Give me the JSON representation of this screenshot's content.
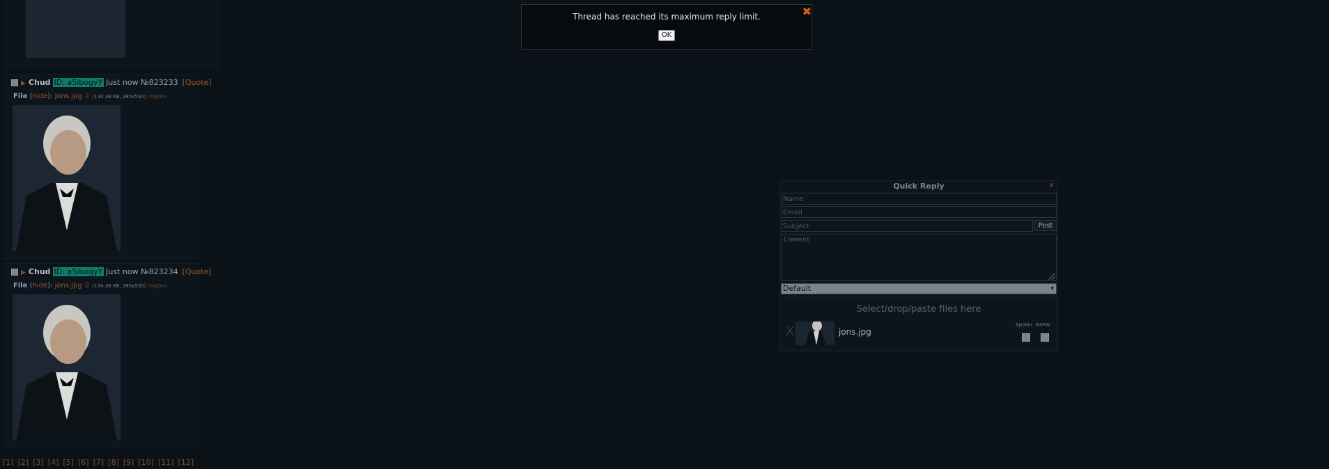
{
  "posts": [
    {
      "name": "Chud",
      "id_label": "ID: a5ibogyY",
      "time": "Just now",
      "number": "№823233",
      "quote_label": "[Quote]",
      "file_label": "File",
      "hide_label": "hide",
      "filename": "jons.jpg",
      "file_meta": "(134.38 KB, 385x530)",
      "imgops_label": "ImgOps"
    },
    {
      "name": "Chud",
      "id_label": "ID: a5ibogyY",
      "time": "Just now",
      "number": "№823234",
      "quote_label": "[Quote]",
      "file_label": "File",
      "hide_label": "hide",
      "filename": "jons.jpg",
      "file_meta": "(134.38 KB, 385x530)",
      "imgops_label": "ImgOps"
    }
  ],
  "pagination": [
    "[1]",
    "[2]",
    "[3]",
    "[4]",
    "[5]",
    "[6]",
    "[7]",
    "[8]",
    "[9]",
    "[10]",
    "[11]",
    "[12]"
  ],
  "dialog": {
    "message": "Thread has reached its maximum reply limit.",
    "ok_label": "OK",
    "close_icon": "close-x-icon",
    "close_color": "#d85f17"
  },
  "quick_reply": {
    "title": "Quick Reply",
    "close_label": "×",
    "name_placeholder": "Name",
    "email_placeholder": "Email",
    "subject_placeholder": "Subject",
    "post_label": "Post",
    "comment_placeholder": "Comment",
    "flag_selected": "Default",
    "dropzone_hint": "Select/drop/paste files here",
    "remove_label": "X",
    "file_name": "jons.jpg",
    "spoiler_label": "Spoiler",
    "nsfw_label": "NSFW"
  },
  "colors": {
    "background": "#0a1117",
    "accent_link": "#a0552a",
    "id_badge": "#0f7e68"
  }
}
